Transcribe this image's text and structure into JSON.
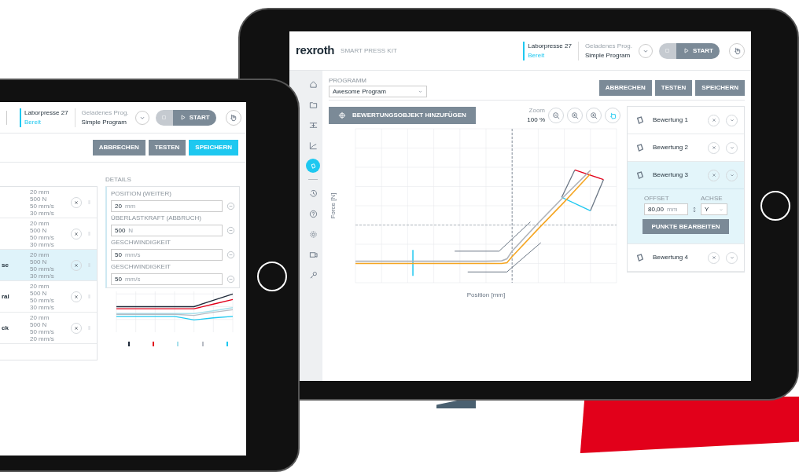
{
  "left_tablet": {
    "header": {
      "machine": "Laborpresse 27",
      "machine_status": "Bereit",
      "program_label": "Geladenes Prog.",
      "program_name": "Simple Program",
      "start_button": "START"
    },
    "buttons": [
      {
        "label": "ABBRECHEN",
        "primary": false
      },
      {
        "label": "TESTEN",
        "primary": false
      },
      {
        "label": "SPEICHERN",
        "primary": true
      }
    ],
    "steps": [
      {
        "selected": false,
        "specs": [
          "20 mm",
          "500 N",
          "50 mm/s",
          "30 mm/s"
        ]
      },
      {
        "selected": false,
        "specs": [
          "20 mm",
          "500 N",
          "50 mm/s",
          "30 mm/s"
        ]
      },
      {
        "name": "se",
        "selected": true,
        "specs": [
          "20 mm",
          "500 N",
          "50 mm/s",
          "30 mm/s"
        ]
      },
      {
        "name": "ral",
        "selected": false,
        "specs": [
          "20 mm",
          "500 N",
          "50 mm/s",
          "30 mm/s"
        ]
      },
      {
        "name": "ck",
        "selected": false,
        "specs": [
          "20 mm",
          "500 N",
          "50 mm/s",
          "20 mm/s"
        ]
      }
    ],
    "details": {
      "title": "DETAILS",
      "fields": [
        {
          "label": "POSITION (WEITER)",
          "value": "20",
          "unit": "mm"
        },
        {
          "label": "ÜBERLASTKRAFT (ABBRUCH)",
          "value": "500",
          "unit": "N"
        },
        {
          "label": "GESCHWINDIGKEIT",
          "value": "50",
          "unit": "mm/s"
        },
        {
          "label": "GESCHWINDIGKEIT",
          "value": "50",
          "unit": "mm/s"
        }
      ]
    },
    "legend": [
      {
        "color": "#1f2a3a"
      },
      {
        "color": "#e2001a"
      },
      {
        "color": "#a8e0ec"
      },
      {
        "color": "#b8bcc4"
      },
      {
        "color": "#1ec8f0"
      }
    ]
  },
  "right_tablet": {
    "header": {
      "logo": "rexroth",
      "product": "SMART PRESS KIT",
      "machine": "Laborpresse 27",
      "machine_status": "Bereit",
      "program_label": "Geladenes Prog.",
      "program_name": "Simple Program",
      "start_button": "START"
    },
    "sidebar": [
      {
        "kind": "home",
        "selected": false
      },
      {
        "kind": "folder",
        "selected": false
      },
      {
        "kind": "align",
        "selected": false
      },
      {
        "kind": "chart",
        "selected": false
      },
      {
        "kind": "evaluation",
        "selected": true
      },
      {
        "kind": "divider"
      },
      {
        "kind": "history",
        "selected": false
      },
      {
        "kind": "help",
        "selected": false
      },
      {
        "kind": "settings",
        "selected": false
      },
      {
        "kind": "device",
        "selected": false
      },
      {
        "kind": "key",
        "selected": false
      }
    ],
    "program_field": {
      "label": "PROGRAMM",
      "value": "Awesome Program"
    },
    "buttons": [
      {
        "label": "ABBRECHEN",
        "primary": false
      },
      {
        "label": "TESTEN",
        "primary": false
      },
      {
        "label": "SPEICHERN",
        "primary": false
      }
    ],
    "add_button": "BEWERTUNGSOBJEKT HINZUFÜGEN",
    "zoom": {
      "label": "Zoom",
      "value": "100 %"
    },
    "zoom_tools": [
      {
        "kind": "zoom-out",
        "selected": false
      },
      {
        "kind": "zoom-in",
        "selected": false
      },
      {
        "kind": "zoom-in",
        "selected": false
      },
      {
        "kind": "pan",
        "selected": true
      }
    ],
    "chart": {
      "xlabel": "Position [mm]",
      "ylabel": "Force [N]"
    },
    "evaluations": [
      {
        "label": "Bewertung 1",
        "selected": false
      },
      {
        "label": "Bewertung 2",
        "selected": false
      },
      {
        "label": "Bewertung 3",
        "selected": true,
        "offset_label": "OFFSET",
        "offset_value": "80,00",
        "offset_unit": "mm",
        "axis_label": "ACHSE",
        "axis_value": "Y",
        "edit_button": "PUNKTE BEARBEITEN"
      },
      {
        "label": "Bewertung 4",
        "selected": false
      }
    ]
  }
}
